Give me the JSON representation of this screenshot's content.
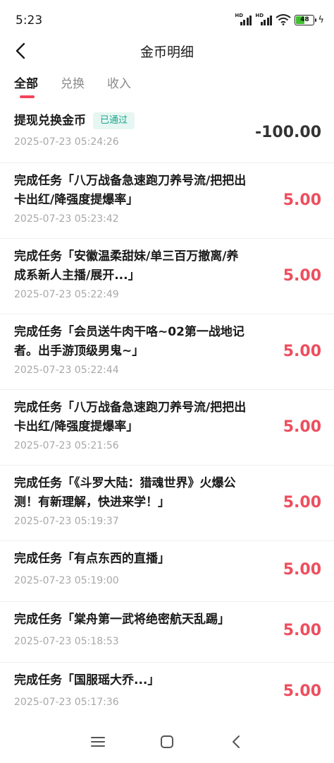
{
  "status": {
    "time": "5:23",
    "battery": "48"
  },
  "header": {
    "title": "金币明细"
  },
  "tabs": [
    {
      "label": "全部"
    },
    {
      "label": "兑换"
    },
    {
      "label": "收入"
    }
  ],
  "records": [
    {
      "title": "提现兑换金币",
      "badge": "已通过",
      "time": "2025-07-23 05:24:26",
      "amount": "-100.00"
    },
    {
      "title": "完成任务「八万战备急速跑刀养号流/把把出卡出红/降强度提爆率」",
      "time": "2025-07-23 05:23:42",
      "amount": "5.00"
    },
    {
      "title": "完成任务「安徽温柔甜妹/单三百万撤离/养成系新人主播/展开...」",
      "time": "2025-07-23 05:22:49",
      "amount": "5.00"
    },
    {
      "title": "完成任务「会员送牛肉干咯~02第一战地记者。出手游顶级男鬼~」",
      "time": "2025-07-23 05:22:44",
      "amount": "5.00"
    },
    {
      "title": "完成任务「八万战备急速跑刀养号流/把把出卡出红/降强度提爆率」",
      "time": "2025-07-23 05:21:56",
      "amount": "5.00"
    },
    {
      "title": "完成任务「《斗罗大陆：猎魂世界》火爆公测！有新理解，快进来学！」",
      "time": "2025-07-23 05:19:37",
      "amount": "5.00"
    },
    {
      "title": "完成任务「有点东西的直播」",
      "time": "2025-07-23 05:19:00",
      "amount": "5.00"
    },
    {
      "title": "完成任务「棠舟第一武将绝密航天乱踢」",
      "time": "2025-07-23 05:18:53",
      "amount": "5.00"
    },
    {
      "title": "完成任务「国服瑶大乔...」",
      "time": "2025-07-23 05:17:36",
      "amount": "5.00"
    }
  ]
}
